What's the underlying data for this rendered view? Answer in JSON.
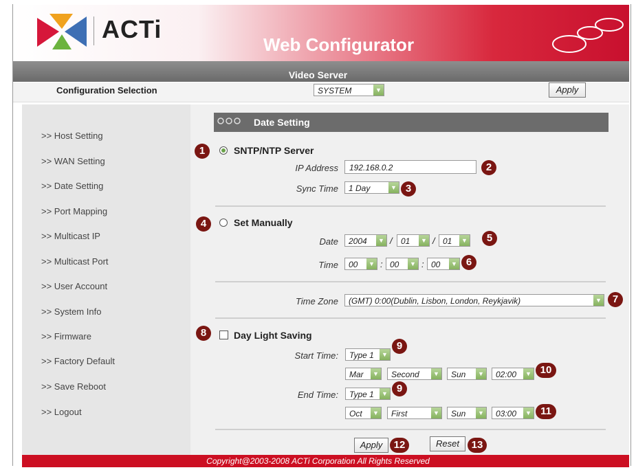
{
  "header": {
    "logo_text": "ACTi",
    "title": "Web Configurator"
  },
  "subheader": {
    "title": "Video Server"
  },
  "config_row": {
    "label": "Configuration Selection",
    "selected": "SYSTEM",
    "apply_label": "Apply"
  },
  "sidebar": {
    "items": [
      {
        "label": ">> Host Setting"
      },
      {
        "label": ">> WAN Setting"
      },
      {
        "label": ">> Date Setting"
      },
      {
        "label": ">> Port Mapping"
      },
      {
        "label": ">> Multicast IP"
      },
      {
        "label": ">> Multicast Port"
      },
      {
        "label": ">> User Account"
      },
      {
        "label": ">> System Info"
      },
      {
        "label": ">> Firmware"
      },
      {
        "label": ">> Factory Default"
      },
      {
        "label": ">> Save Reboot"
      },
      {
        "label": ">> Logout"
      }
    ]
  },
  "panel": {
    "title": "Date Setting"
  },
  "sntp": {
    "label": "SNTP/NTP Server",
    "selected": true,
    "ip_label": "IP Address",
    "ip_value": "192.168.0.2",
    "sync_label": "Sync Time",
    "sync_value": "1 Day"
  },
  "manual": {
    "label": "Set Manually",
    "selected": false,
    "date_label": "Date",
    "year": "2004",
    "month": "01",
    "day": "01",
    "time_label": "Time",
    "hour": "00",
    "minute": "00",
    "second": "00"
  },
  "timezone": {
    "label": "Time Zone",
    "value": "(GMT) 0:00(Dublin, Lisbon, London, Reykjavik)"
  },
  "dst": {
    "label": "Day Light Saving",
    "checked": false,
    "start_label": "Start Time:",
    "start_type": "Type 1",
    "start_month": "Mar",
    "start_week": "Second",
    "start_day": "Sun",
    "start_time": "02:00",
    "end_label": "End Time:",
    "end_type": "Type 1",
    "end_month": "Oct",
    "end_week": "First",
    "end_day": "Sun",
    "end_time": "03:00"
  },
  "actions": {
    "apply_label": "Apply",
    "reset_label": "Reset"
  },
  "callouts": [
    "1",
    "2",
    "3",
    "4",
    "5",
    "6",
    "7",
    "8",
    "9",
    "9",
    "10",
    "11",
    "12",
    "13"
  ],
  "separators": {
    "date_sep": "/",
    "time_sep": ":"
  },
  "footer": {
    "text": "Copyright@2003-2008 ACTi Corporation All Rights Reserved"
  },
  "colors": {
    "brand_red": "#cc0f22",
    "panel_gray": "#6c6c6c",
    "callout": "#7a1612",
    "select_arrow": "#86b35f"
  }
}
